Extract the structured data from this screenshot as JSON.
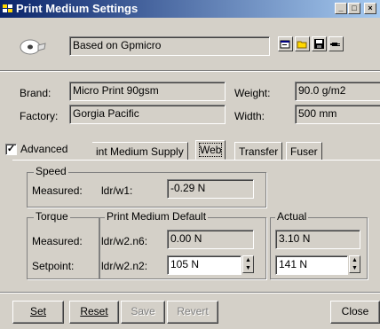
{
  "window": {
    "title": "Print Medium Settings",
    "min_glyph": "_",
    "max_glyph": "□",
    "close_glyph": "×"
  },
  "header": {
    "profile_value": "Based on Gpmicro"
  },
  "toolbar": {
    "icons": [
      "properties-icon",
      "open-folder-icon",
      "save-disk-icon",
      "plug-icon"
    ]
  },
  "info": {
    "brand_label": "Brand:",
    "brand_value": "Micro Print 90gsm",
    "factory_label": "Factory:",
    "factory_value": "Gorgia Pacific",
    "weight_label": "Weight:",
    "weight_value": "90.0 g/m2",
    "width_label": "Width:",
    "width_value": "500 mm"
  },
  "advanced": {
    "checked": true,
    "check_glyph": "✓",
    "label": "Advanced"
  },
  "tabs": [
    {
      "label": "int Medium Supply"
    },
    {
      "label": "Web"
    },
    {
      "label": "Transfer"
    },
    {
      "label": "Fuser"
    }
  ],
  "speed": {
    "legend": "Speed",
    "measured_label": "Measured:",
    "param_label": "ldr/w1:",
    "value": "-0.29 N"
  },
  "torque": {
    "legend": "Torque",
    "default_legend": "Print Medium Default",
    "actual_legend": "Actual",
    "measured_label": "Measured:",
    "setpoint_label": "Setpoint:",
    "measured_param": "ldr/w2.n6:",
    "setpoint_param": "ldr/w2.n2:",
    "measured_default": "0.00 N",
    "measured_actual": "3.10 N",
    "setpoint_default": "105 N",
    "setpoint_actual": "141 N",
    "spin_up": "▲",
    "spin_down": "▼"
  },
  "buttons": {
    "set": "Set",
    "reset": "Reset",
    "save": "Save",
    "revert": "Revert",
    "close": "Close"
  },
  "colors": {
    "face": "#d4d0c8",
    "title_start": "#0a246a",
    "title_end": "#a6caf0"
  }
}
